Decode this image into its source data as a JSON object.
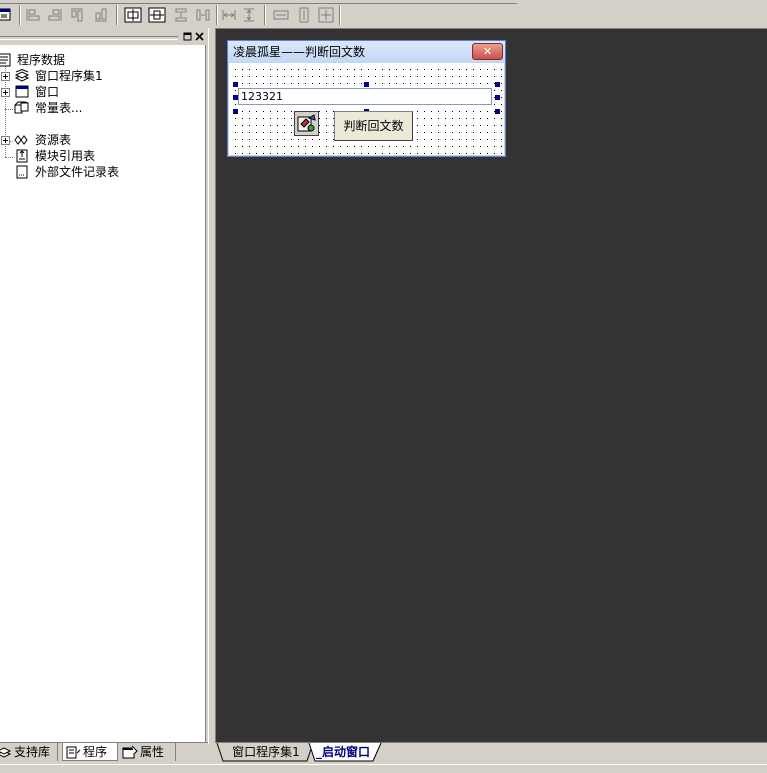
{
  "toolbar": {
    "buttons": [
      "window-icon",
      "align-left-icon",
      "align-right-icon",
      "align-top-icon",
      "align-bottom-icon",
      "center-horizontal-icon",
      "center-vertical-icon",
      "space-horizontal-icon",
      "space-vertical-icon",
      "equal-spacing-horizontal-icon",
      "equal-spacing-vertical-icon",
      "same-width-icon",
      "same-height-icon",
      "same-size-icon"
    ]
  },
  "tree": {
    "root": "程序数据",
    "items": [
      {
        "label": "窗口程序集1",
        "icon": "assembly-icon",
        "expandable": true
      },
      {
        "label": "窗口",
        "icon": "window-icon",
        "expandable": true
      },
      {
        "label": "常量表...",
        "icon": "constants-icon",
        "expandable": false
      },
      {
        "label": "资源表",
        "icon": "resources-icon",
        "expandable": true
      },
      {
        "label": "模块引用表",
        "icon": "module-ref-icon",
        "expandable": false
      },
      {
        "label": "外部文件记录表",
        "icon": "external-file-icon",
        "expandable": false
      }
    ]
  },
  "left_tabs": [
    {
      "label": "支持库",
      "icon": "library-icon",
      "active": false
    },
    {
      "label": "程序",
      "icon": "program-icon",
      "active": true
    },
    {
      "label": "属性",
      "icon": "properties-icon",
      "active": false
    }
  ],
  "form": {
    "title": "凌晨孤星——判断回文数",
    "close_label": "✕",
    "edit_value": "123321",
    "button_label": "判断回文数"
  },
  "designer_tabs": [
    {
      "label": "窗口程序集1",
      "active": false
    },
    {
      "label": "_启动窗口",
      "active": true
    }
  ],
  "colors": {
    "designer_background": "#333333",
    "selection_handle": "#000080",
    "title_gradient_top": "#dbe8fb"
  }
}
